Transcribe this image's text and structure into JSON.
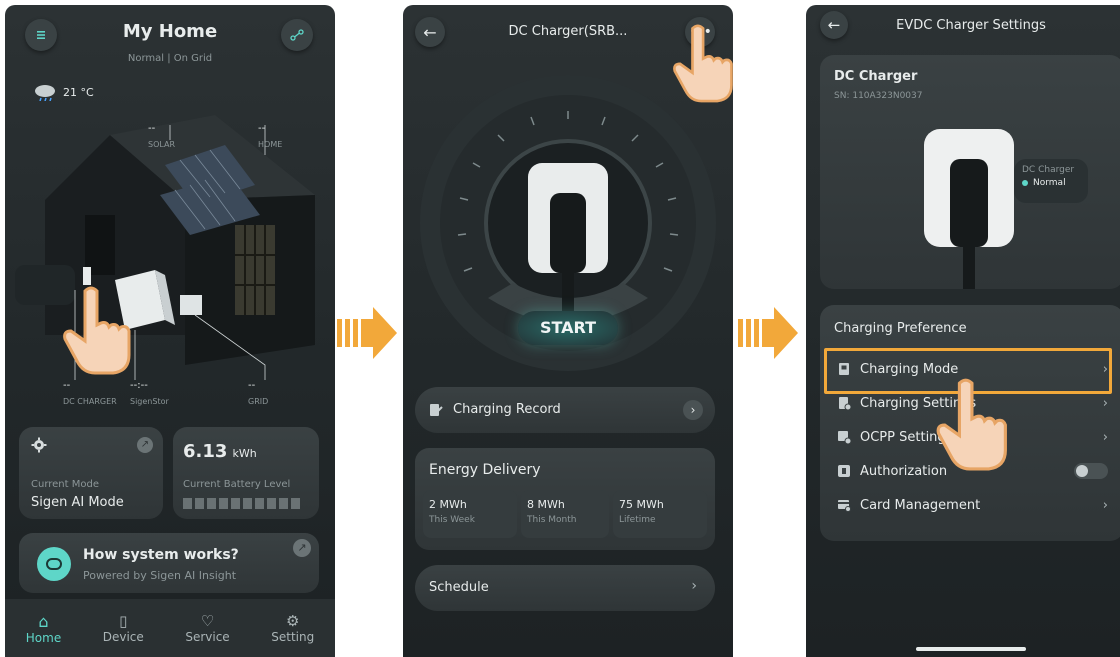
{
  "screen1": {
    "title": "My Home",
    "status": "Normal | On Grid",
    "weather_temp": "21 °C",
    "labels": {
      "solar_value": "--",
      "solar": "SOLAR",
      "home_value": "--",
      "home": "HOME",
      "dc_charger_value": "--",
      "dc_charger": "DC CHARGER",
      "sigenstor_value": "--:--",
      "sigenstor": "SigenStor",
      "grid_value": "--",
      "grid": "GRID"
    },
    "mode_card": {
      "label": "Current Mode",
      "value": "Sigen AI Mode"
    },
    "battery_card": {
      "value": "6.13",
      "unit": "kWh",
      "label": "Current Battery Level"
    },
    "promo": {
      "title": "How system works?",
      "subtitle": "Powered by Sigen AI Insight"
    },
    "nav": [
      {
        "label": "Home",
        "icon": "home-icon"
      },
      {
        "label": "Device",
        "icon": "device-icon"
      },
      {
        "label": "Service",
        "icon": "service-icon"
      },
      {
        "label": "Setting",
        "icon": "setting-icon"
      }
    ]
  },
  "screen2": {
    "title": "DC Charger(SRB...",
    "start_label": "START",
    "charging_record": "Charging Record",
    "energy": {
      "title": "Energy Delivery",
      "items": [
        {
          "value": "2 MWh",
          "label": "This Week"
        },
        {
          "value": "8 MWh",
          "label": "This Month"
        },
        {
          "value": "75 MWh",
          "label": "Lifetime"
        }
      ]
    },
    "schedule": "Schedule"
  },
  "screen3": {
    "title": "EVDC Charger Settings",
    "device_name": "DC Charger",
    "serial": "SN: 110A323N0037",
    "tag_name": "DC Charger",
    "tag_status": "Normal",
    "section_title": "Charging Preference",
    "items": [
      {
        "label": "Charging Mode",
        "icon": "charging-mode-icon"
      },
      {
        "label": "Charging Settings",
        "icon": "charging-settings-icon"
      },
      {
        "label": "OCPP Settings",
        "icon": "ocpp-icon"
      },
      {
        "label": "Authorization",
        "icon": "authorization-icon"
      },
      {
        "label": "Card Management",
        "icon": "card-icon"
      }
    ]
  },
  "colors": {
    "accent": "#5ed6c8",
    "highlight": "#f2a83a",
    "background": "#262c2e"
  }
}
